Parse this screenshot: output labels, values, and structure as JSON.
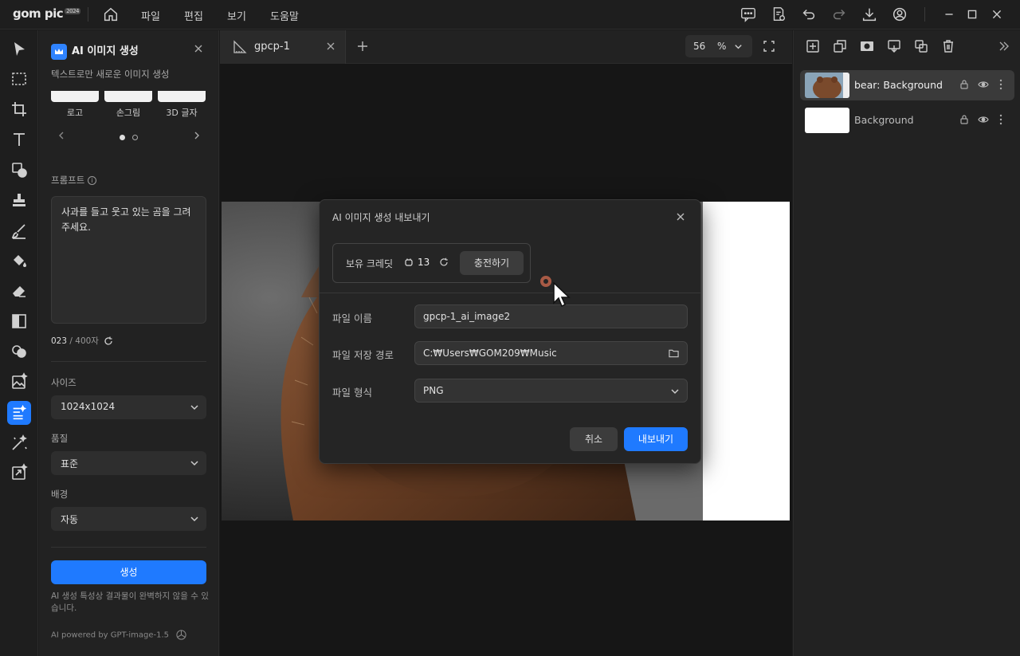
{
  "app": {
    "logo": "gom pic",
    "logo_badge": "2024",
    "menu": [
      "파일",
      "편집",
      "보기",
      "도움말"
    ]
  },
  "left_panel": {
    "title": "AI 이미지 생성",
    "subtitle": "텍스트로만 새로운 이미지 생성",
    "styles": [
      "로고",
      "손그림",
      "3D 글자"
    ],
    "prompt_label": "프롬프트",
    "prompt_text": "사과를 들고 웃고 있는 곰을 그려 주세요.",
    "char_count": "023",
    "char_max": " / 400자",
    "size_label": "사이즈",
    "size_value": "1024x1024",
    "quality_label": "품질",
    "quality_value": "표준",
    "background_label": "배경",
    "background_value": "자동",
    "generate_label": "생성",
    "note": "AI 생성 특성상 결과물이 완벽하지 않을 수 있습니다.",
    "powered_by": "AI powered by GPT-image-1.5"
  },
  "tabs": {
    "active_tab": "gpcp-1"
  },
  "zoom": {
    "value": "56",
    "unit": "%"
  },
  "layers": [
    {
      "name": "bear: Background",
      "selected": true
    },
    {
      "name": "Background",
      "selected": false
    }
  ],
  "dialog": {
    "title": "AI 이미지 생성 내보내기",
    "credit_label": "보유 크레딧",
    "credit_value": "13",
    "charge_label": "충전하기",
    "filename_label": "파일 이름",
    "filename_value": "gpcp-1_ai_image2",
    "path_label": "파일 저장 경로",
    "path_value": "C:₩Users₩GOM209₩Music",
    "format_label": "파일 형식",
    "format_value": "PNG",
    "cancel_label": "취소",
    "export_label": "내보내기"
  },
  "colors": {
    "accent": "#1f7aff",
    "background": "#1b1b1b",
    "panel": "#222222"
  }
}
